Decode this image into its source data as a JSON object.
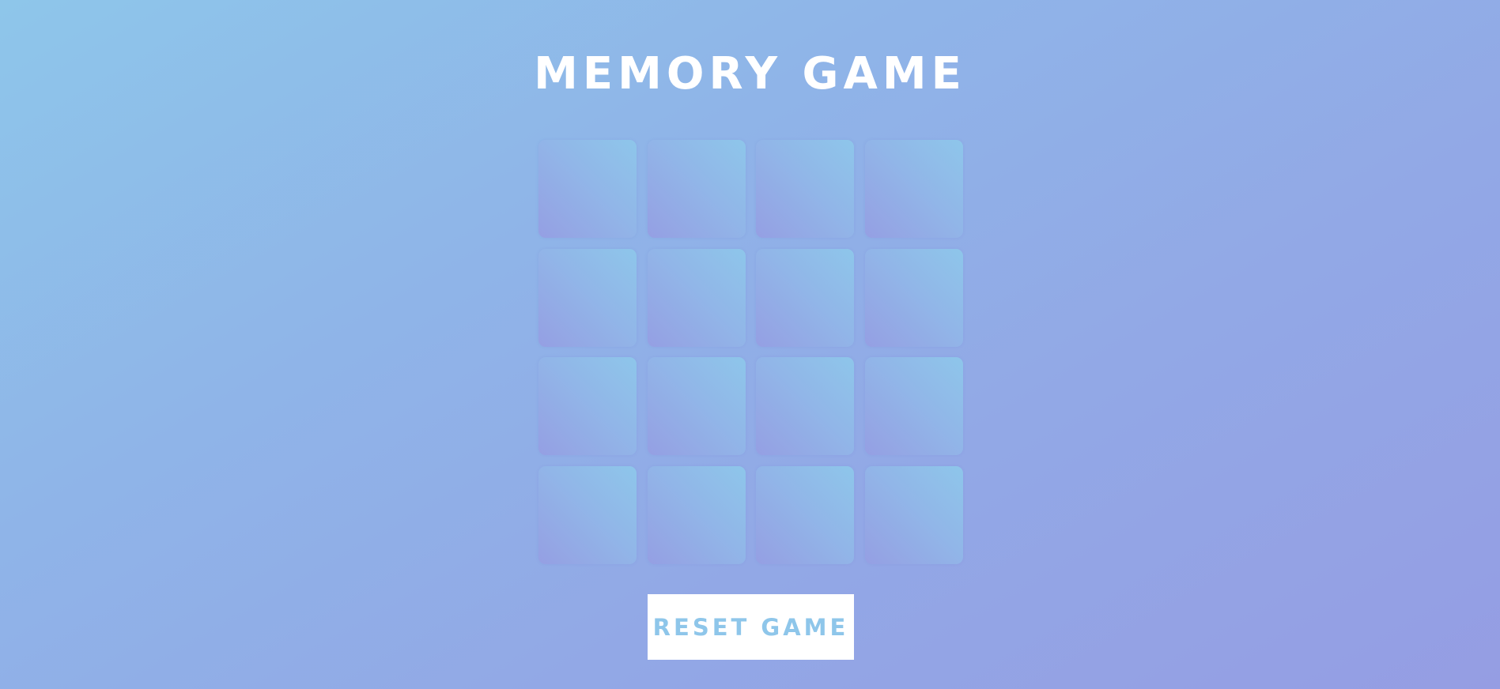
{
  "header": {
    "title": "MEMORY GAME"
  },
  "board": {
    "rows": 4,
    "columns": 4,
    "cards": [
      {
        "state": "face-down"
      },
      {
        "state": "face-down"
      },
      {
        "state": "face-down"
      },
      {
        "state": "face-down"
      },
      {
        "state": "face-down"
      },
      {
        "state": "face-down"
      },
      {
        "state": "face-down"
      },
      {
        "state": "face-down"
      },
      {
        "state": "face-down"
      },
      {
        "state": "face-down"
      },
      {
        "state": "face-down"
      },
      {
        "state": "face-down"
      },
      {
        "state": "face-down"
      },
      {
        "state": "face-down"
      },
      {
        "state": "face-down"
      },
      {
        "state": "face-down"
      }
    ]
  },
  "controls": {
    "reset_label": "RESET GAME"
  },
  "colors": {
    "background_start": "#8ec6ea",
    "background_end": "#959de3",
    "title_text": "#ffffff",
    "button_background": "#ffffff",
    "button_text": "#8ec6ea"
  }
}
